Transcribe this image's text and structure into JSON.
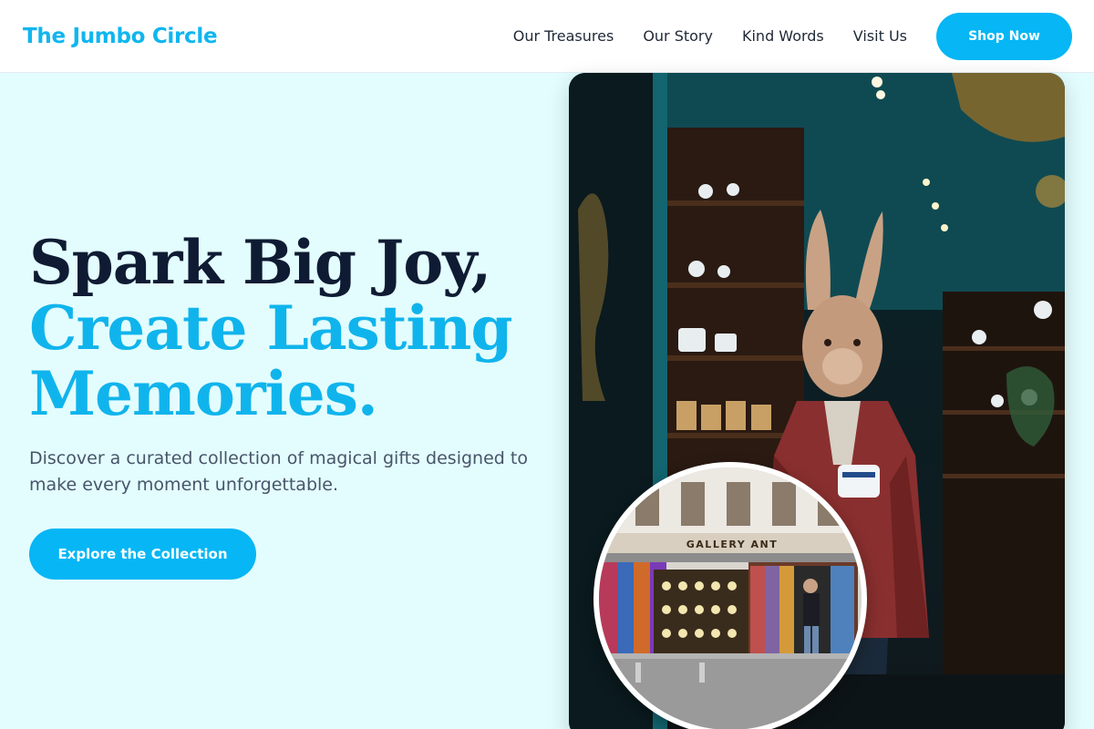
{
  "brand": {
    "name": "The Jumbo Circle"
  },
  "nav": {
    "items": [
      {
        "label": "Our Treasures"
      },
      {
        "label": "Our Story"
      },
      {
        "label": "Kind Words"
      },
      {
        "label": "Visit Us"
      }
    ],
    "cta_label": "Shop Now"
  },
  "hero": {
    "headline_line1": "Spark Big Joy,",
    "headline_line2": "Create Lasting",
    "headline_line3": "Memories.",
    "subtext": "Discover a curated collection of magical gifts designed to make every moment unforgettable.",
    "cta_label": "Explore the Collection"
  },
  "photo": {
    "main_subject": "rabbit-statue-in-antique-shop",
    "inset_subject": "gallery-storefront",
    "inset_sign_text": "GALLERY ANT"
  },
  "colors": {
    "accent": "#06b6f5",
    "brand_text": "#0fb6ef",
    "headline_dark": "#0f1b33",
    "hero_bg": "#e3fdfe"
  }
}
